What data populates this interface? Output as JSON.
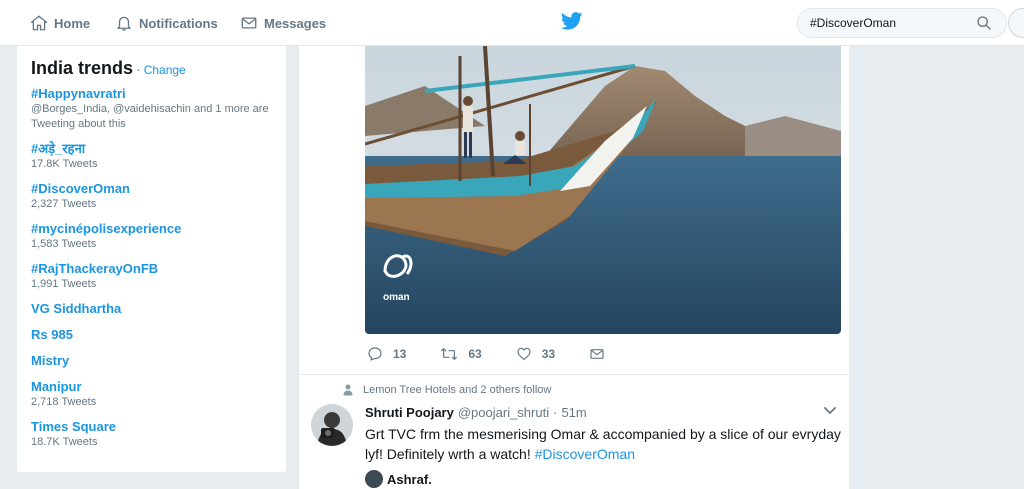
{
  "nav": {
    "home": "Home",
    "notifications": "Notifications",
    "messages": "Messages"
  },
  "search": {
    "value": "#DiscoverOman"
  },
  "trends": {
    "title": "India trends",
    "separator": "·",
    "change": "Change",
    "items": [
      {
        "name": "#Happynavratri",
        "meta": "@Borges_India, @vaidehisachin and 1 more are Tweeting about this"
      },
      {
        "name": "#अड़े_रहना",
        "meta": "17.8K Tweets"
      },
      {
        "name": "#DiscoverOman",
        "meta": "2,327 Tweets"
      },
      {
        "name": "#mycinépolisexperience",
        "meta": "1,583 Tweets"
      },
      {
        "name": "#RajThackerayOnFB",
        "meta": "1,991 Tweets"
      },
      {
        "name": "VG Siddhartha",
        "meta": ""
      },
      {
        "name": "Rs 985",
        "meta": ""
      },
      {
        "name": "Mistry",
        "meta": ""
      },
      {
        "name": "Manipur",
        "meta": "2,718 Tweets"
      },
      {
        "name": "Times Square",
        "meta": "18.7K Tweets"
      }
    ]
  },
  "tweet1": {
    "media_logo_text": "oman",
    "replies": "13",
    "retweets": "63",
    "likes": "33"
  },
  "tweet2": {
    "context": "Lemon Tree Hotels and 2 others follow",
    "author": "Shruti Poojary",
    "handle": "@poojari_shruti",
    "dot": "·",
    "time": "51m",
    "text": "Grt TVC frm the mesmerising Omar & accompanied by a slice of our evryday lyf! Definitely wrth a watch!",
    "hashtag": "#DiscoverOman",
    "quote_author": "Ashraf."
  },
  "colors": {
    "accent": "#1b95e0",
    "background": "#e6ecf0",
    "muted": "#657786",
    "twitter_blue": "#1da1f2"
  }
}
